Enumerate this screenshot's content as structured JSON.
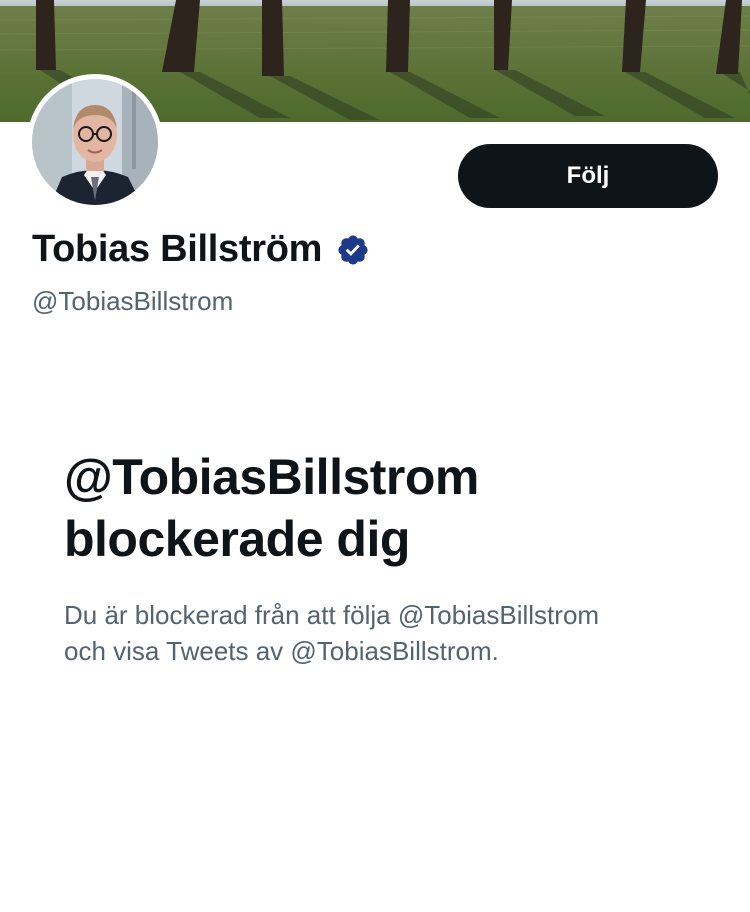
{
  "profile": {
    "display_name": "Tobias Billström",
    "handle": "@TobiasBillstrom",
    "verified": true,
    "follow_label": "Följ"
  },
  "blocked": {
    "title_line1": "@TobiasBillstrom",
    "title_line2": "blockerade dig",
    "desc_line1": "Du är blockerad från att följa @TobiasBillstrom",
    "desc_line2": "och visa Tweets av @TobiasBillstrom."
  },
  "colors": {
    "text_primary": "#0f1419",
    "text_secondary": "#536471",
    "button_bg": "#0f1419",
    "verified_badge": "#1d3a8a"
  },
  "icons": {
    "verified": "verified-badge-icon"
  }
}
